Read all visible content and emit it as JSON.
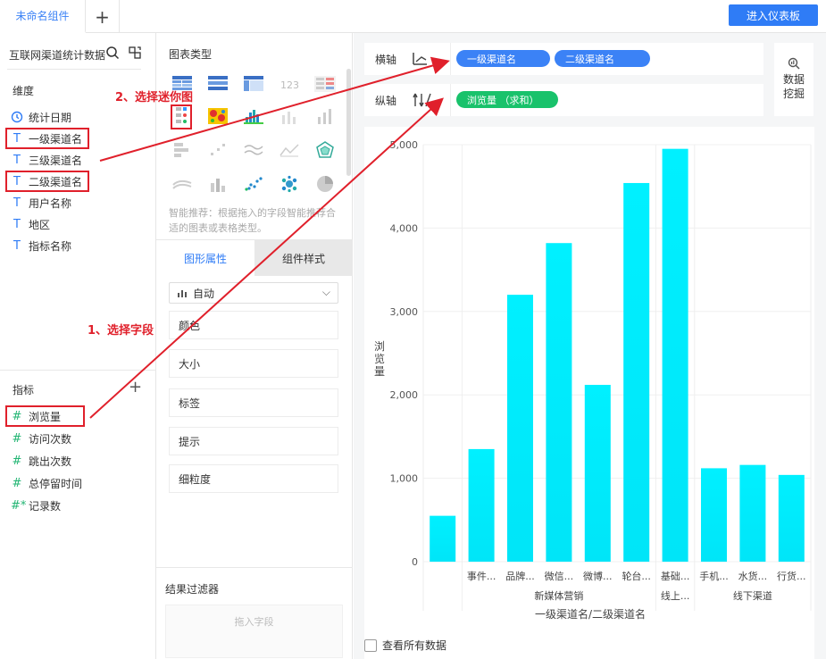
{
  "topbar": {
    "tab_label": "未命名组件",
    "add_label": "+",
    "enter_button": "进入仪表板"
  },
  "left": {
    "dataset_title": "互联网渠道统计数据",
    "dimensions_header": "维度",
    "dimensions": [
      {
        "icon": "clock-icon",
        "label": "统计日期"
      },
      {
        "icon": "text-type-icon",
        "label": "一级渠道名"
      },
      {
        "icon": "text-type-icon",
        "label": "三级渠道名"
      },
      {
        "icon": "text-type-icon",
        "label": "二级渠道名"
      },
      {
        "icon": "text-type-icon",
        "label": "用户名称"
      },
      {
        "icon": "text-type-icon",
        "label": "地区"
      },
      {
        "icon": "text-type-icon",
        "label": "指标名称"
      }
    ],
    "metrics_header": "指标",
    "metrics": [
      {
        "icon": "hash-icon",
        "label": "浏览量"
      },
      {
        "icon": "hash-icon",
        "label": "访问次数"
      },
      {
        "icon": "hash-icon",
        "label": "跳出次数"
      },
      {
        "icon": "hash-icon",
        "label": "总停留时间"
      },
      {
        "icon": "hash-star-icon",
        "label": "记录数"
      }
    ]
  },
  "middle": {
    "chart_type_title": "图表类型",
    "hint": "智能推荐：根据拖入的字段智能推荐合适的图表或表格类型。",
    "tab_props": "图形属性",
    "tab_style": "组件样式",
    "auto_select": "自动",
    "props": [
      "颜色",
      "大小",
      "标签",
      "提示",
      "细粒度"
    ],
    "filter_title": "结果过滤器",
    "filter_placeholder": "拖入字段"
  },
  "right": {
    "x_axis_label": "横轴",
    "y_axis_label": "纵轴",
    "x_pills": [
      "一级渠道名",
      "二级渠道名"
    ],
    "y_pills": [
      "浏览量 （求和）"
    ],
    "mining_line1": "数据",
    "mining_line2": "挖掘",
    "view_all": "查看所有数据"
  },
  "annotations": {
    "step1": "1、选择字段",
    "step2": "2、选择迷你图"
  },
  "colors": {
    "accent": "#2f7cf6",
    "bar_top": "#00f0ff",
    "bar_bottom": "#00e5f8",
    "annotation": "#e0202b",
    "pill_green": "#19c26b"
  },
  "chart_data": {
    "type": "bar",
    "ylabel": "浏览量",
    "xlabel": "一级渠道名/二级渠道名",
    "ylim": [
      0,
      5000
    ],
    "yticks": [
      "0",
      "1,000",
      "2,000",
      "3,000",
      "4,000",
      "5,000"
    ],
    "groups": [
      {
        "name": "",
        "categories": [
          ""
        ],
        "values": [
          550
        ]
      },
      {
        "name": "新媒体营销",
        "categories": [
          "事件...",
          "品牌...",
          "微信...",
          "微博...",
          "轮台..."
        ],
        "values": [
          1350,
          3200,
          3820,
          2120,
          4540
        ]
      },
      {
        "name": "线上...",
        "categories": [
          "基础..."
        ],
        "values": [
          4950
        ]
      },
      {
        "name": "线下渠道",
        "categories": [
          "手机...",
          "水货...",
          "行货..."
        ],
        "values": [
          1120,
          1160,
          1040
        ]
      }
    ]
  }
}
